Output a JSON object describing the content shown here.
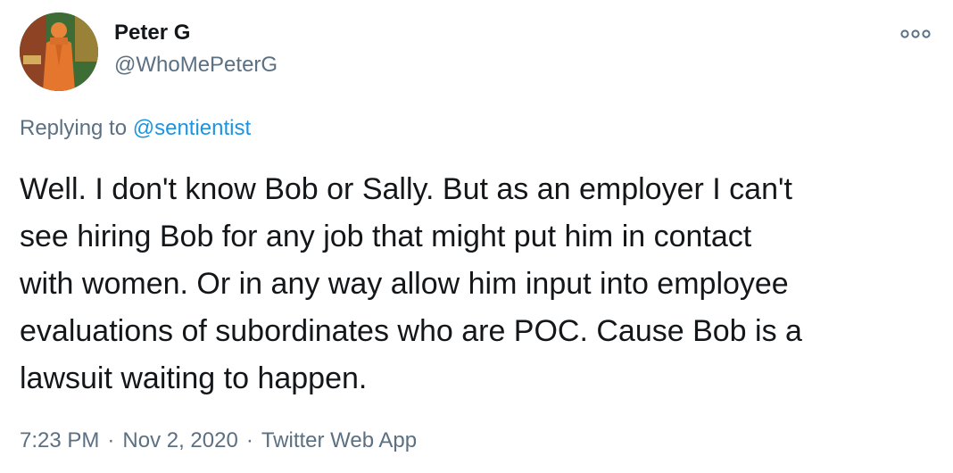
{
  "author": {
    "name": "Peter G",
    "handle": "@WhoMePeterG"
  },
  "reply": {
    "prefix": "Replying to",
    "to": "@sentientist"
  },
  "body_lines": [
    "Well. I don't know Bob or Sally. But as an employer I can't",
    "see hiring Bob for any job that might put him in contact",
    "with women.  Or in any way allow him input into employee",
    "evaluations of subordinates who are POC. Cause Bob is a",
    "lawsuit waiting to happen."
  ],
  "meta": {
    "time": "7:23 PM",
    "separator": "·",
    "date": "Nov 2, 2020",
    "source": "Twitter Web App"
  },
  "icons": {
    "more": "more-options-icon",
    "avatar": "avatar"
  },
  "colors": {
    "text": "#14171a",
    "secondary": "#5b7083",
    "link": "#1b95e0"
  }
}
